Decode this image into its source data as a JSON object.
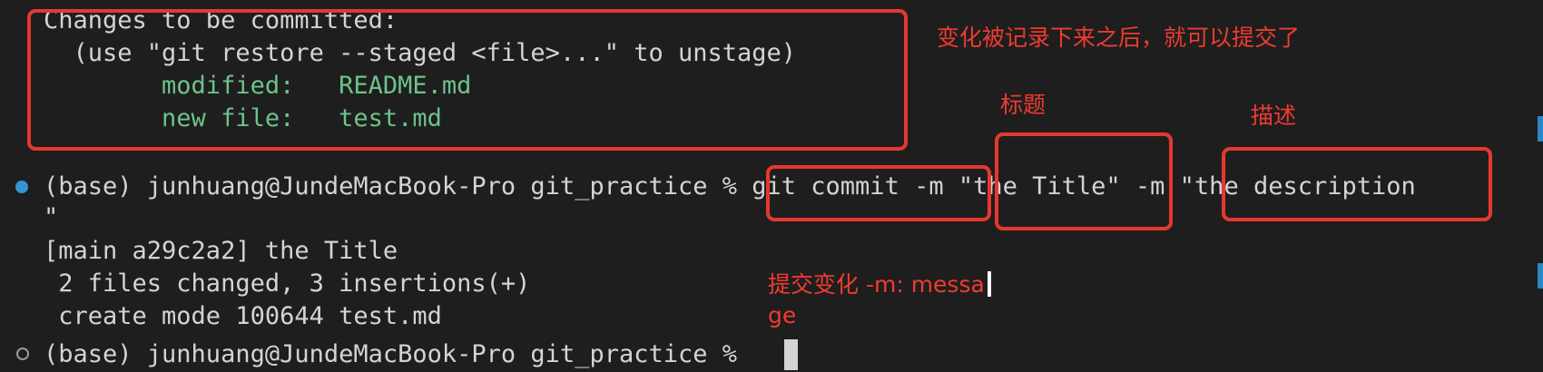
{
  "terminal": {
    "lines": {
      "staged_header": "Changes to be committed:",
      "restore_hint": "  (use \"git restore --staged <file>...\" to unstage)",
      "modified_label": "        modified:   ",
      "modified_file": "README.md",
      "newfile_label": "        new file:   ",
      "newfile_file": "test.md",
      "prompt_1": "(base) junhuang@JundeMacBook-Pro git_practice % ",
      "command": "git commit -m \"the Title\" -m \"the description",
      "command_wrap": "\"",
      "commit_result": "[main a29c2a2] the Title",
      "files_changed": " 2 files changed, 3 insertions(+)",
      "create_mode": " create mode 100644 test.md",
      "prompt_2": "(base) junhuang@JundeMacBook-Pro git_practice % "
    }
  },
  "annotations": {
    "staged_note": "变化被记录下来之后，就可以提交了",
    "title_note": "标题",
    "desc_note": "描述",
    "commit_note_1": "提交变化 -m: messa",
    "commit_note_2": "ge"
  },
  "colors": {
    "background": "#1e1e1e",
    "text": "#d4d4d4",
    "green": "#6cc38a",
    "annotation_red": "#e5382e",
    "status_blue": "#3794d4"
  },
  "icons": {
    "status_success": "filled-circle",
    "status_idle": "hollow-circle"
  }
}
